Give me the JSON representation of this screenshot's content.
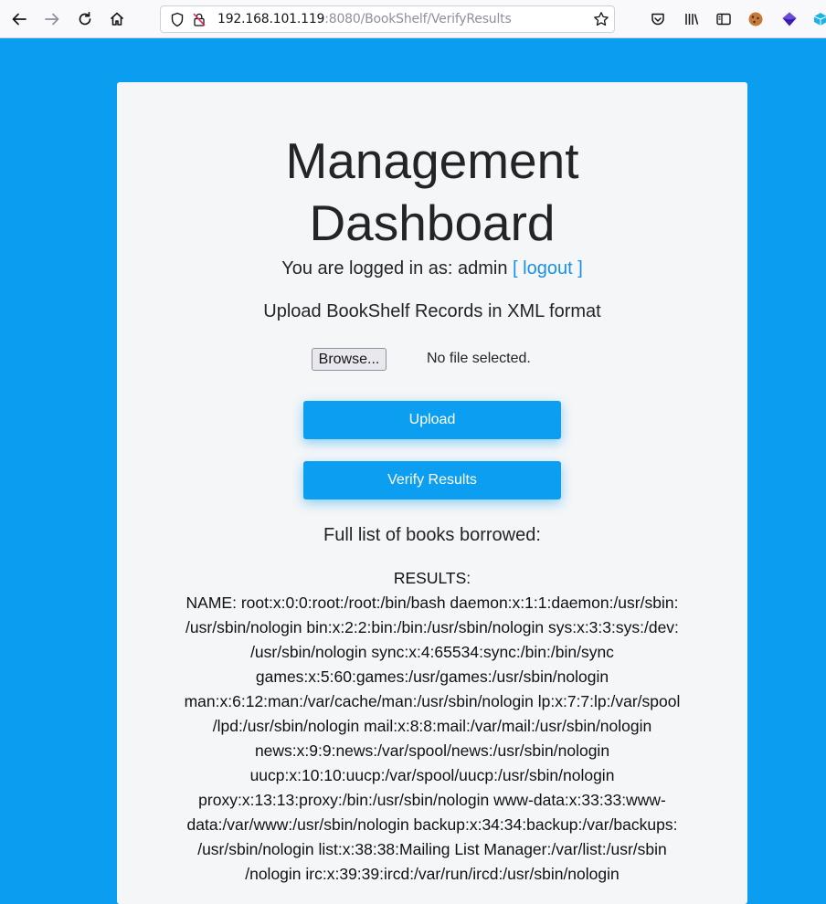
{
  "browser": {
    "url_host": "192.168.101.119",
    "url_rest": ":8080/BookShelf/VerifyResults"
  },
  "page": {
    "title_line1": "Management",
    "title_line2": "Dashboard",
    "login_prefix": "You are logged in as: admin",
    "logout_label": "[ logout ]",
    "upload_heading": "Upload BookShelf Records in XML format",
    "browse_label": "Browse...",
    "file_status": "No file selected.",
    "upload_label": "Upload",
    "verify_label": "Verify Results",
    "list_heading": "Full list of books borrowed:",
    "results_label": "RESULTS:",
    "results_text": "NAME: root:x:0:0:root:/root:/bin/bash daemon:x:1:1:daemon:/usr/sbin:\n/usr/sbin/nologin bin:x:2:2:bin:/bin:/usr/sbin/nologin sys:x:3:3:sys:/dev:\n/usr/sbin/nologin sync:x:4:65534:sync:/bin:/bin/sync\ngames:x:5:60:games:/usr/games:/usr/sbin/nologin\nman:x:6:12:man:/var/cache/man:/usr/sbin/nologin lp:x:7:7:lp:/var/spool\n/lpd:/usr/sbin/nologin mail:x:8:8:mail:/var/mail:/usr/sbin/nologin\nnews:x:9:9:news:/var/spool/news:/usr/sbin/nologin\nuucp:x:10:10:uucp:/var/spool/uucp:/usr/sbin/nologin\nproxy:x:13:13:proxy:/bin:/usr/sbin/nologin www-data:x:33:33:www-\ndata:/var/www:/usr/sbin/nologin backup:x:34:34:backup:/var/backups:\n/usr/sbin/nologin list:x:38:38:Mailing List Manager:/var/list:/usr/sbin\n/nologin irc:x:39:39:ircd:/var/run/ircd:/usr/sbin/nologin"
  },
  "colors": {
    "page_background": "#0b9ef0",
    "button_blue": "#0c9ef0",
    "link_blue": "#1a8fe6"
  }
}
